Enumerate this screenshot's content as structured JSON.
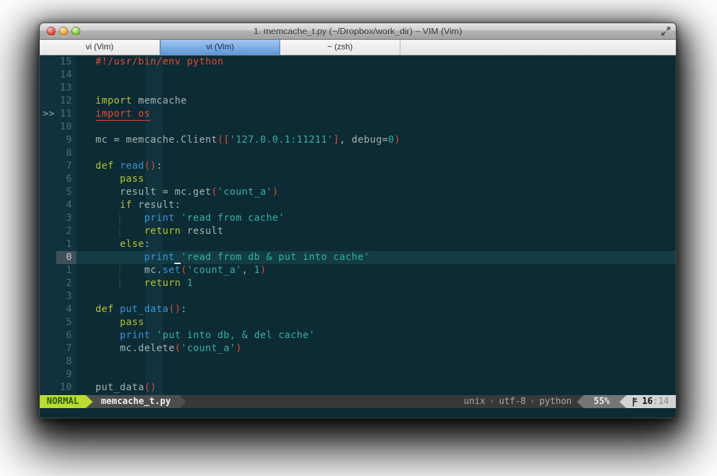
{
  "window": {
    "title": "1. memcache_t.py (~/Dropbox/work_dir) – VIM (Vim)"
  },
  "tabs": [
    {
      "label": "vi (Vim)",
      "active": false
    },
    {
      "label": "vi (Vim)",
      "active": true
    },
    {
      "label": "~ (zsh)",
      "active": false
    }
  ],
  "theme": {
    "bg": "#0c2b34",
    "gutter_bg": "#0f323d",
    "band": "#11333e",
    "cursorline": "#133c47",
    "cursor_linenr_bg": "#3f5058",
    "fg": "#a6b4b0",
    "linenr": "#556b72",
    "red": "#e64a33",
    "yellow": "#b9c22e",
    "blue": "#3697da",
    "cyan": "#35b3a2",
    "mode_bg": "#b9dc2f",
    "mode_fg": "#275c0d"
  },
  "editor": {
    "rows": [
      {
        "num": "15",
        "tokens": [
          {
            "t": "#!/usr/bin/env python",
            "c": "r"
          }
        ]
      },
      {
        "num": "14",
        "tokens": []
      },
      {
        "num": "13",
        "tokens": []
      },
      {
        "num": "12",
        "tokens": [
          {
            "t": "import",
            "c": "k"
          },
          {
            "t": " memcache",
            "c": "d"
          }
        ]
      },
      {
        "num": "11",
        "sign": ">>",
        "tokens": [
          {
            "t": "import os",
            "c": "e"
          }
        ]
      },
      {
        "num": "10",
        "tokens": []
      },
      {
        "num": "9",
        "tokens": [
          {
            "t": "mc = memcache.Client",
            "c": "d"
          },
          {
            "t": "([",
            "c": "r"
          },
          {
            "t": "'127.0.0.1:11211'",
            "c": "s"
          },
          {
            "t": "]",
            "c": "r"
          },
          {
            "t": ", debug=",
            "c": "d"
          },
          {
            "t": "0",
            "c": "n"
          },
          {
            "t": ")",
            "c": "r"
          }
        ]
      },
      {
        "num": "8",
        "tokens": []
      },
      {
        "num": "7",
        "tokens": [
          {
            "t": "def",
            "c": "k"
          },
          {
            "t": " ",
            "c": "d"
          },
          {
            "t": "read",
            "c": "b"
          },
          {
            "t": "()",
            "c": "r"
          },
          {
            "t": ":",
            "c": "d"
          }
        ]
      },
      {
        "num": "6",
        "tokens": [
          {
            "t": "    ",
            "c": "d"
          },
          {
            "t": "pass",
            "c": "k"
          }
        ]
      },
      {
        "num": "5",
        "tokens": [
          {
            "t": "    result = mc.get",
            "c": "d"
          },
          {
            "t": "(",
            "c": "r"
          },
          {
            "t": "'count_a'",
            "c": "s"
          },
          {
            "t": ")",
            "c": "r"
          }
        ]
      },
      {
        "num": "4",
        "tokens": [
          {
            "t": "    ",
            "c": "d"
          },
          {
            "t": "if",
            "c": "k"
          },
          {
            "t": " result:",
            "c": "d"
          }
        ]
      },
      {
        "num": "3",
        "g": true,
        "tokens": [
          {
            "t": "        ",
            "c": "d"
          },
          {
            "t": "print",
            "c": "b"
          },
          {
            "t": " ",
            "c": "d"
          },
          {
            "t": "'read from cache'",
            "c": "s"
          }
        ]
      },
      {
        "num": "2",
        "g": true,
        "tokens": [
          {
            "t": "        ",
            "c": "d"
          },
          {
            "t": "return",
            "c": "k"
          },
          {
            "t": " result",
            "c": "d"
          }
        ]
      },
      {
        "num": "1",
        "tokens": [
          {
            "t": "    ",
            "c": "d"
          },
          {
            "t": "else",
            "c": "k"
          },
          {
            "t": ":",
            "c": "d"
          }
        ]
      },
      {
        "num": "0",
        "cursor": true,
        "tokens": [
          {
            "t": "        ",
            "c": "d"
          },
          {
            "t": "print",
            "c": "b"
          },
          {
            "t": " ",
            "c": "cur"
          },
          {
            "t": "'read from db & put into cache'",
            "c": "s"
          }
        ]
      },
      {
        "num": "1",
        "g": true,
        "tokens": [
          {
            "t": "        mc.",
            "c": "d"
          },
          {
            "t": "set",
            "c": "b"
          },
          {
            "t": "(",
            "c": "r"
          },
          {
            "t": "'count_a'",
            "c": "s"
          },
          {
            "t": ", ",
            "c": "d"
          },
          {
            "t": "1",
            "c": "n"
          },
          {
            "t": ")",
            "c": "r"
          }
        ]
      },
      {
        "num": "2",
        "g": true,
        "tokens": [
          {
            "t": "        ",
            "c": "d"
          },
          {
            "t": "return",
            "c": "k"
          },
          {
            "t": " ",
            "c": "d"
          },
          {
            "t": "1",
            "c": "n"
          }
        ]
      },
      {
        "num": "3",
        "tokens": []
      },
      {
        "num": "4",
        "tokens": [
          {
            "t": "def",
            "c": "k"
          },
          {
            "t": " ",
            "c": "d"
          },
          {
            "t": "put_data",
            "c": "b"
          },
          {
            "t": "()",
            "c": "r"
          },
          {
            "t": ":",
            "c": "d"
          }
        ]
      },
      {
        "num": "5",
        "tokens": [
          {
            "t": "    ",
            "c": "d"
          },
          {
            "t": "pass",
            "c": "k"
          }
        ]
      },
      {
        "num": "6",
        "tokens": [
          {
            "t": "    ",
            "c": "d"
          },
          {
            "t": "print",
            "c": "b"
          },
          {
            "t": " ",
            "c": "d"
          },
          {
            "t": "'put into db, & del cache'",
            "c": "s"
          }
        ]
      },
      {
        "num": "7",
        "tokens": [
          {
            "t": "    mc.delete",
            "c": "d"
          },
          {
            "t": "(",
            "c": "r"
          },
          {
            "t": "'count_a'",
            "c": "s"
          },
          {
            "t": ")",
            "c": "r"
          }
        ]
      },
      {
        "num": "8",
        "tokens": []
      },
      {
        "num": "9",
        "tokens": []
      },
      {
        "num": "10",
        "tokens": [
          {
            "t": "put_data",
            "c": "d"
          },
          {
            "t": "()",
            "c": "r"
          }
        ]
      }
    ]
  },
  "statusbar": {
    "mode": "NORMAL",
    "file": "memcache_t.py",
    "right_items": [
      "unix",
      "utf-8",
      "python"
    ],
    "separator": "‹",
    "percent": "55%",
    "time_main": "16",
    "time_rest": ":14"
  }
}
